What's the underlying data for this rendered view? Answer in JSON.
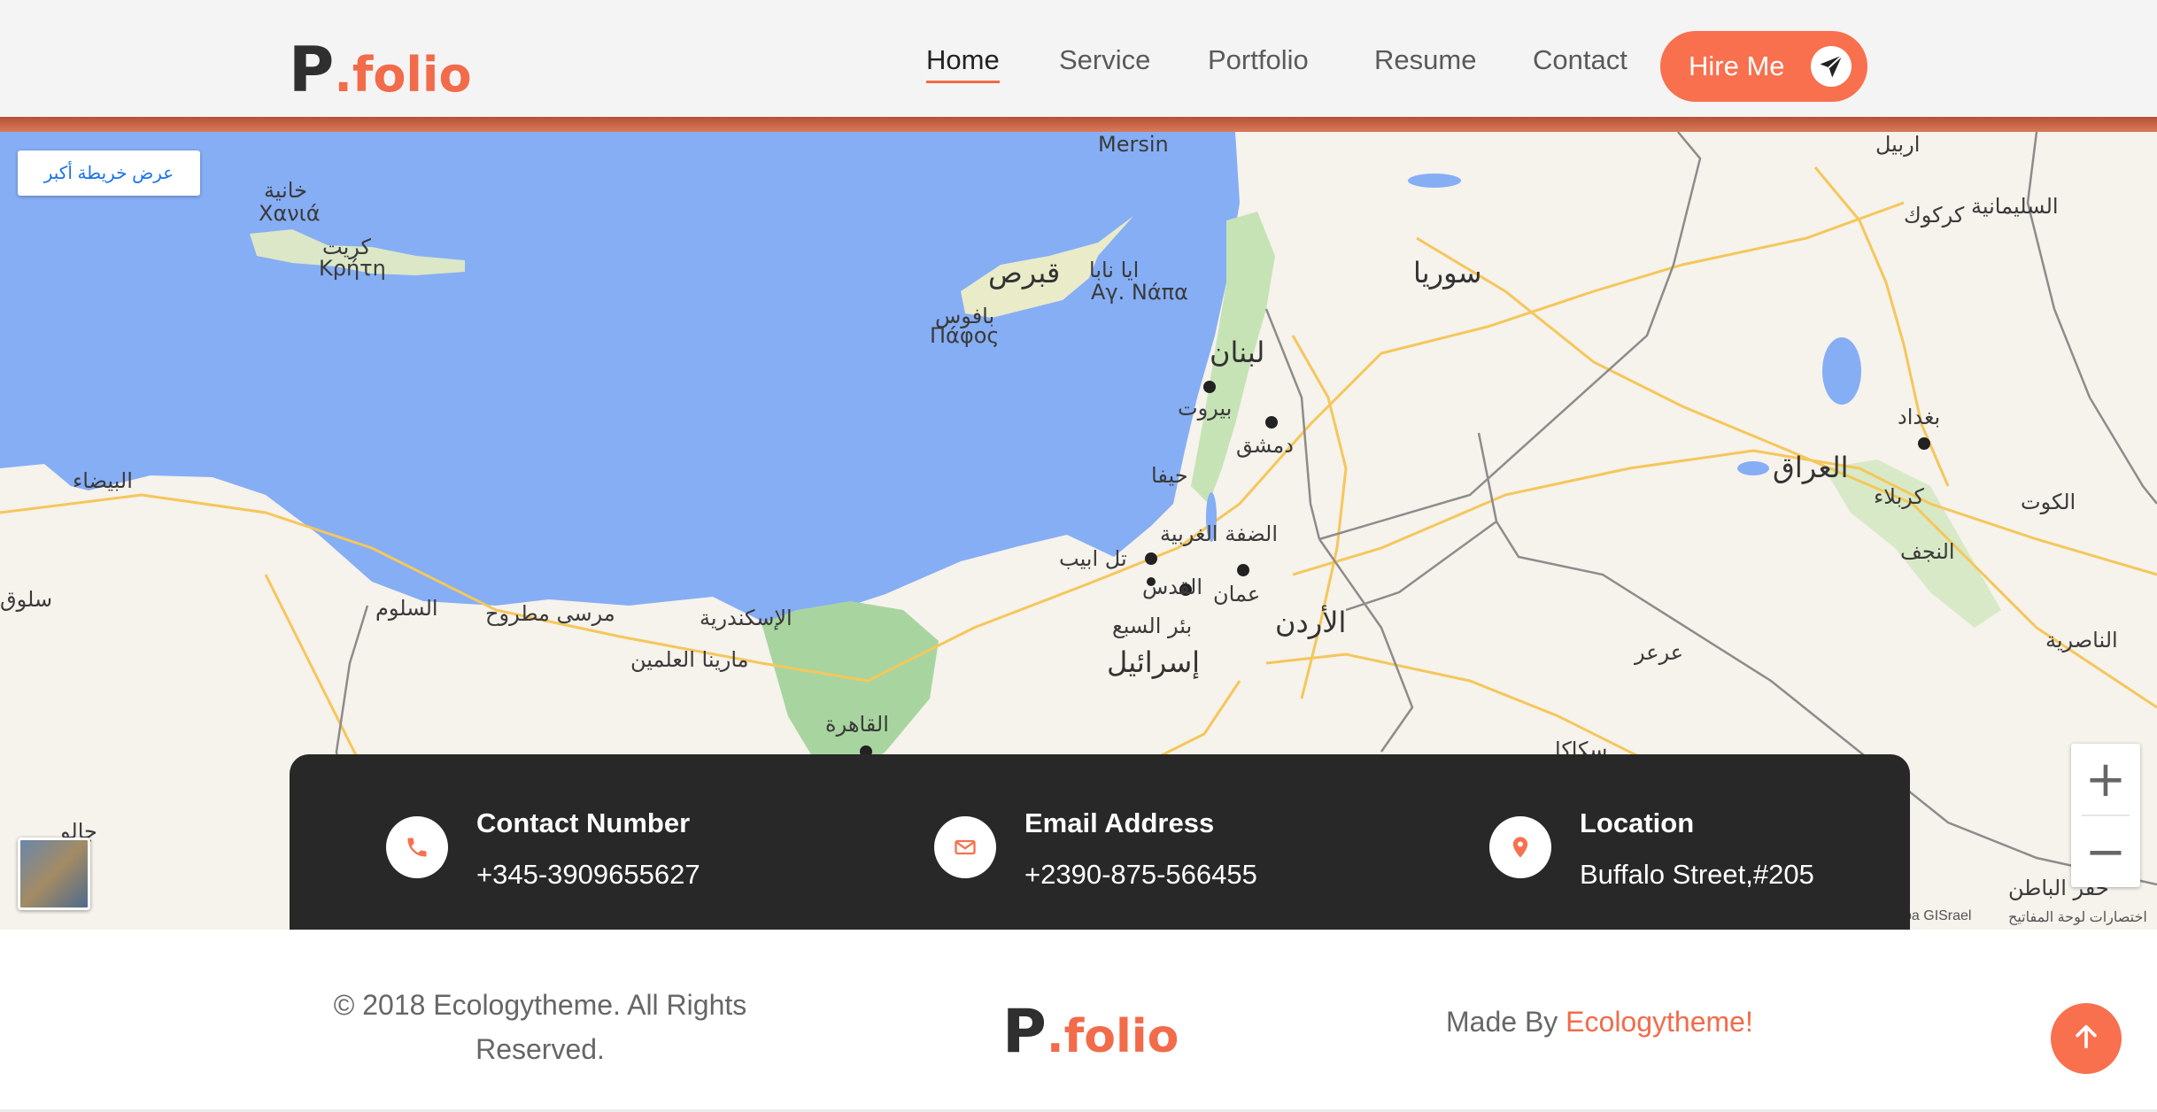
{
  "header": {
    "logo": {
      "p": "P",
      "dot": ".",
      "folio": "folio"
    },
    "nav": [
      {
        "label": "Home",
        "active": true
      },
      {
        "label": "Service",
        "active": false
      },
      {
        "label": "Portfolio",
        "active": false
      },
      {
        "label": "Resume",
        "active": false
      },
      {
        "label": "Contact",
        "active": false
      }
    ],
    "hire_button": {
      "label": "Hire Me",
      "icon": "paper-plane-icon"
    }
  },
  "map": {
    "larger_map_label": "عرض خريطة أكبر",
    "labels": {
      "mersin": "Mersin",
      "syria": "سوريا",
      "iraq": "العراق",
      "lebanon": "لبنان",
      "beirut": "بيروت",
      "damascus": "دمشق",
      "cyprus": "قبرص",
      "jordan": "الأردن",
      "israel": "إسرائيل",
      "baghdad": "بغداد",
      "amman": "عمان",
      "jerusalem": "القدس",
      "tel_aviv": "تل ابيب",
      "alexandria": "الإسكندرية",
      "cairo": "القاهرة",
      "chania_ar": "خانية",
      "chania_gr": "Χανιά",
      "crete_ar": "كريت",
      "crete_gr": "Κρήτη",
      "ayia_napa_ar": "ايا نابا",
      "ayia_napa_gr": "Αγ. Νάπα",
      "paphos_ar": "بافوس",
      "paphos_gr": "Πάφος",
      "erbil": "اربيل",
      "kirkuk": "كركوك",
      "sulaymaniyah": "السليمانية",
      "karbala": "كربلاء",
      "najaf": "النجف",
      "kut": "الكوت",
      "nasiriyah": "الناصرية",
      "haifa": "حيفا",
      "west_bank": "الضفة الغربية",
      "beersheba": "بئر السبع",
      "marsa_matruh": "مرسى مطروح",
      "salloum": "السلوم",
      "el_alamein": "مارينا العلمين",
      "al_bayda": "البيضاء",
      "arar": "عرعر",
      "hafar_al_batin": "حفر الباطن",
      "sakaka": "سكاكا",
      "jalu": "جالو",
      "sulaq": "سلوق"
    },
    "zoom_in": "+",
    "zoom_out": "−",
    "attribution": "pa GISrael",
    "shortcuts": "اختصارات لوحة المفاتيح"
  },
  "contact": [
    {
      "title": "Contact Number",
      "value": "+345-3909655627",
      "icon": "phone-icon"
    },
    {
      "title": "Email Address",
      "value": "+2390-875-566455",
      "icon": "envelope-icon"
    },
    {
      "title": "Location",
      "value": "Buffalo Street,#205",
      "icon": "location-pin-icon"
    }
  ],
  "footer": {
    "copyright": "© 2018 Ecologytheme. All Rights Reserved.",
    "made_by_prefix": "Made By ",
    "made_by_brand": "Ecologytheme!",
    "back_to_top_icon": "arrow-up-icon"
  },
  "colors": {
    "accent": "#f8704e",
    "dark_bar": "#282828",
    "sea": "#86aef5",
    "land": "#f6f2ec",
    "header_bg": "#f4f4f4"
  }
}
